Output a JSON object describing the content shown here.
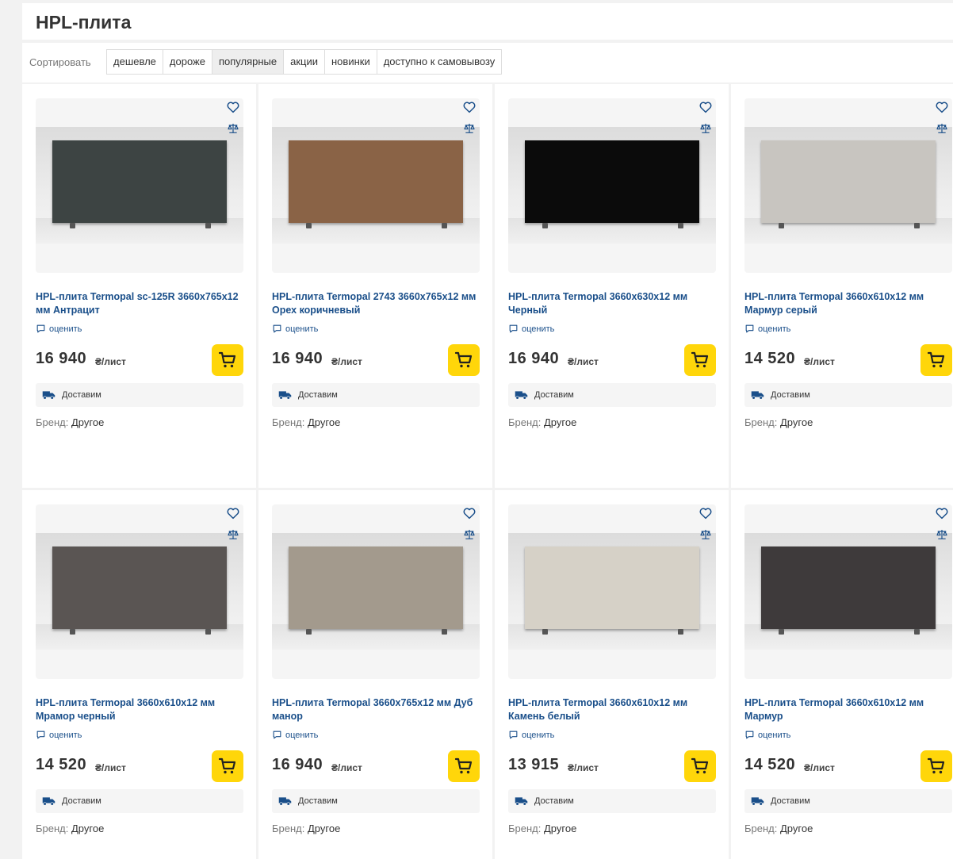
{
  "page": {
    "title": "HPL-плита"
  },
  "sort": {
    "label": "Сортировать",
    "options": [
      "дешевле",
      "дороже",
      "популярные",
      "акции",
      "новинки",
      "доступно к самовывозу"
    ],
    "active": "популярные"
  },
  "product_common": {
    "rate_label": "оценить",
    "unit": "₴/лист",
    "delivery_label": "Доставим",
    "brand_label": "Бренд:"
  },
  "products": [
    {
      "name": "HPL-плита Termopal sc-125R 3660x765x12 мм Антрацит",
      "price": "16 940",
      "brand": "Другое",
      "panel_color": "#3d4443"
    },
    {
      "name": "HPL-плита Termopal 2743 3660x765x12 мм Орех коричневый",
      "price": "16 940",
      "brand": "Другое",
      "panel_color": "#8a6346"
    },
    {
      "name": "HPL-плита Termopal 3660x630x12 мм Черный",
      "price": "16 940",
      "brand": "Другое",
      "panel_color": "#0b0b0b"
    },
    {
      "name": "HPL-плита Termopal 3660x610x12 мм Мармур серый",
      "price": "14 520",
      "brand": "Другое",
      "panel_color": "#c8c5c0"
    },
    {
      "name": "HPL-плита Termopal 3660x610x12 мм Мрамор черный",
      "price": "14 520",
      "brand": "Другое",
      "panel_color": "#5a5553"
    },
    {
      "name": "HPL-плита Termopal 3660x765x12 мм Дуб манор",
      "price": "16 940",
      "brand": "Другое",
      "panel_color": "#a39a8d"
    },
    {
      "name": "HPL-плита Termopal 3660x610x12 мм Камень белый",
      "price": "13 915",
      "brand": "Другое",
      "panel_color": "#d6d1c7"
    },
    {
      "name": "HPL-плита Termopal 3660x610x12 мм Мармур",
      "price": "14 520",
      "brand": "Другое",
      "panel_color": "#3e3a3b"
    }
  ],
  "icons": {
    "favorite": "heart-icon",
    "compare": "scales-icon",
    "rate": "comment-icon",
    "cart": "cart-icon",
    "delivery": "truck-icon"
  },
  "colors": {
    "accent": "#ffd60a",
    "link": "#1a4f8a"
  }
}
